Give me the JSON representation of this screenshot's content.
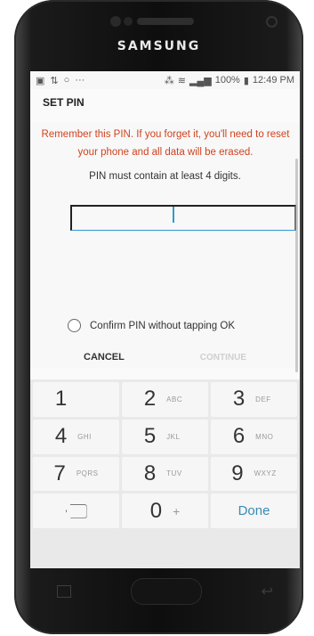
{
  "device": {
    "brand": "SAMSUNG"
  },
  "statusbar": {
    "left_icons": [
      "image-icon",
      "sync-icon",
      "circle-icon",
      "more-icon"
    ],
    "more": "···",
    "battery": "100%",
    "time": "12:49 PM"
  },
  "header": {
    "title": "SET PIN"
  },
  "content": {
    "warning": "Remember this PIN. If you forget it, you'll need to reset your phone and all data will be erased.",
    "hint": "PIN must contain at least 4 digits.",
    "pin_value": ""
  },
  "options": {
    "confirm_label": "Confirm PIN without tapping OK",
    "confirm_checked": false
  },
  "actions": {
    "cancel": "CANCEL",
    "continue": "CONTINUE"
  },
  "keypad": {
    "keys": [
      {
        "digit": "1",
        "letters": ""
      },
      {
        "digit": "2",
        "letters": "ABC"
      },
      {
        "digit": "3",
        "letters": "DEF"
      },
      {
        "digit": "4",
        "letters": "GHI"
      },
      {
        "digit": "5",
        "letters": "JKL"
      },
      {
        "digit": "6",
        "letters": "MNO"
      },
      {
        "digit": "7",
        "letters": "PQRS"
      },
      {
        "digit": "8",
        "letters": "TUV"
      },
      {
        "digit": "9",
        "letters": "WXYZ"
      }
    ],
    "zero": "0",
    "plus": "+",
    "done": "Done"
  },
  "colors": {
    "accent": "#2e9bd0",
    "warning": "#d0421e",
    "done": "#3a8bb5"
  }
}
